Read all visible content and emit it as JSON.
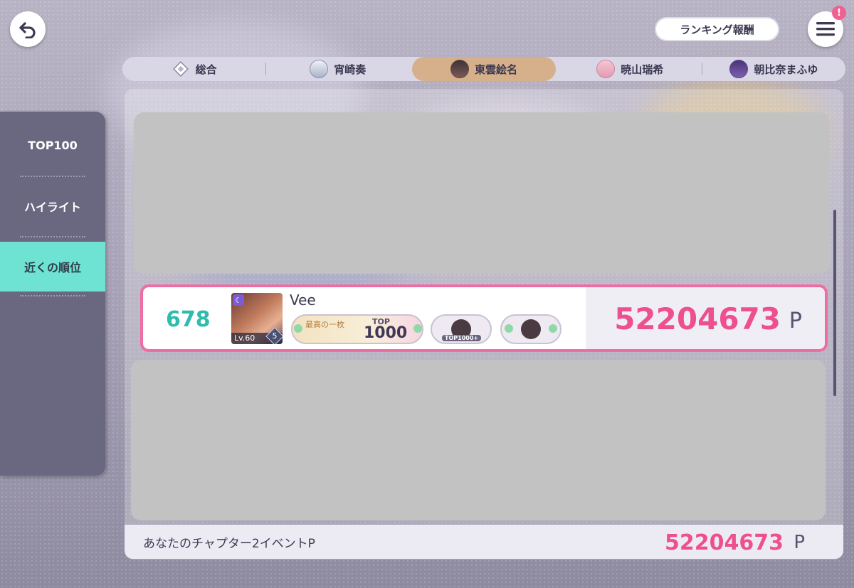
{
  "header": {
    "reward_button_label": "ランキング報酬",
    "menu_badge": "!"
  },
  "tabs": [
    {
      "label": "総合",
      "icon": "diamond-icon",
      "active": false
    },
    {
      "label": "宵崎奏",
      "icon": "kanade-avatar",
      "active": false
    },
    {
      "label": "東雲絵名",
      "icon": "ena-avatar",
      "active": true
    },
    {
      "label": "暁山瑞希",
      "icon": "mizuki-avatar",
      "active": false
    },
    {
      "label": "朝比奈まふゆ",
      "icon": "mafuyu-avatar",
      "active": false
    }
  ],
  "side_menu": {
    "items": [
      {
        "label": "TOP100",
        "active": false
      },
      {
        "label": "ハイライト",
        "active": false
      },
      {
        "label": "近くの順位",
        "active": true
      }
    ]
  },
  "ranking_row": {
    "rank": "678",
    "player_name": "Vee",
    "card_level": "Lv.60",
    "card_mastery": "5",
    "title_tag": "TOP",
    "title_number": "1000",
    "title_text": "最高の一枚",
    "badge_label": "TOP1000+",
    "score": "52204673",
    "unit": "P"
  },
  "footer": {
    "label": "あなたのチャプター2イベントP",
    "score": "52204673",
    "unit": "P"
  },
  "colors": {
    "accent_pink": "#ee4f8f",
    "rank_teal": "#2fbcae",
    "active_tab": "#d6b08a",
    "active_side": "#6ee3d3"
  }
}
